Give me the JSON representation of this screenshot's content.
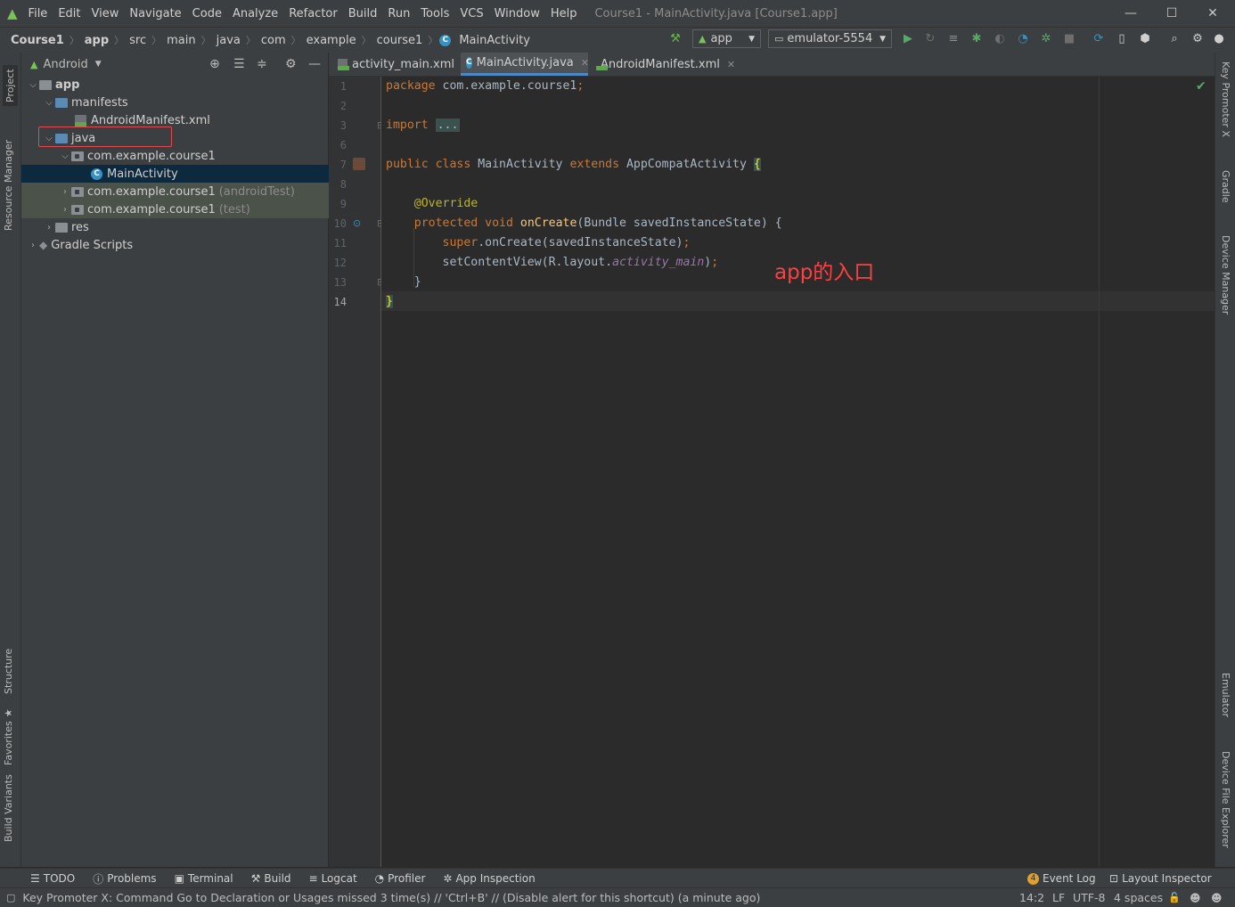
{
  "window": {
    "title": "Course1 - MainActivity.java [Course1.app]",
    "menu": [
      "File",
      "Edit",
      "View",
      "Navigate",
      "Code",
      "Analyze",
      "Refactor",
      "Build",
      "Run",
      "Tools",
      "VCS",
      "Window",
      "Help"
    ],
    "controls": {
      "minimize": "—",
      "maximize": "☐",
      "close": "✕"
    }
  },
  "breadcrumbs": [
    "Course1",
    "app",
    "src",
    "main",
    "java",
    "com",
    "example",
    "course1",
    "MainActivity"
  ],
  "toolbar": {
    "run_config": "app",
    "device": "emulator-5554"
  },
  "left_stripe": [
    "Project",
    "Resource Manager",
    "Structure",
    "Favorites",
    "Build Variants"
  ],
  "right_stripe": [
    "Key Promoter X",
    "Gradle",
    "Device Manager",
    "Emulator",
    "Device File Explorer"
  ],
  "project_panel": {
    "view_mode": "Android",
    "tree": [
      {
        "label": "app",
        "bold": true
      },
      {
        "label": "manifests"
      },
      {
        "label": "AndroidManifest.xml"
      },
      {
        "label": "java"
      },
      {
        "label": "com.example.course1"
      },
      {
        "label": "MainActivity"
      },
      {
        "label": "com.example.course1",
        "suffix": "(androidTest)"
      },
      {
        "label": "com.example.course1",
        "suffix": "(test)"
      },
      {
        "label": "res"
      },
      {
        "label": "Gradle Scripts"
      }
    ]
  },
  "tabs": [
    {
      "label": "activity_main.xml",
      "active": false
    },
    {
      "label": "MainActivity.java",
      "active": true
    },
    {
      "label": "AndroidManifest.xml",
      "active": false
    }
  ],
  "editor": {
    "line_numbers": [
      "1",
      "2",
      "3",
      "6",
      "7",
      "8",
      "9",
      "10",
      "11",
      "12",
      "13",
      "14"
    ],
    "annotation_text": "app的入口",
    "annotation_color": "#ff4040"
  },
  "bottom_tools": [
    "TODO",
    "Problems",
    "Terminal",
    "Build",
    "Logcat",
    "Profiler",
    "App Inspection"
  ],
  "bottom_tools_right": {
    "event_log": "Event Log",
    "event_count": "4",
    "layout_inspector": "Layout Inspector"
  },
  "status": {
    "message": "Key Promoter X: Command Go to Declaration or Usages missed 3 time(s) // 'Ctrl+B' // (Disable alert for this shortcut) (a minute ago)",
    "position": "14:2",
    "line_sep": "LF",
    "encoding": "UTF-8",
    "indent": "4 spaces"
  },
  "colors": {
    "accent": "#4a88c7",
    "highlight_box": "#e5484d",
    "selected_row": "#0d293e"
  }
}
